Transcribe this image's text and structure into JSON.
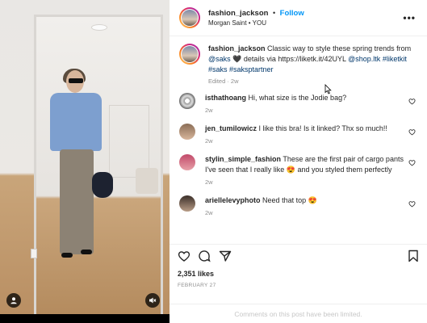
{
  "media": {
    "icons": {
      "user_tag": "person-icon",
      "mute": "speaker-muted-icon"
    }
  },
  "header": {
    "username": "fashion_jackson",
    "separator": "•",
    "follow_label": "Follow",
    "subline": "Morgan Saint • YOU",
    "more_label": "•••"
  },
  "caption": {
    "username": "fashion_jackson",
    "text_1": "Classic way to style these spring trends from",
    "saks": "@saks",
    "heart": "🖤",
    "text_2": "details via https://liketk.it/42UYL",
    "shop": "@shop.ltk",
    "tags1": "#liketkit",
    "tags2": "#saks #saksptartner",
    "meta": "Edited · 2w"
  },
  "comments": [
    {
      "user": "isthathoang",
      "text": "Hi, what size is the Jodie bag?",
      "time": "2w"
    },
    {
      "user": "jen_tumilowicz",
      "text": "I like this bra! Is it linked? Thx so much!!",
      "time": "2w"
    },
    {
      "user": "stylin_simple_fashion",
      "text": "These are the first pair of cargo pants I've seen that I really like 😍 and you styled them perfectly",
      "time": "2w"
    },
    {
      "user": "ariellelevyphoto",
      "text": "Need that top 😍",
      "time": "2w"
    }
  ],
  "stats": {
    "likes": "2,351 likes",
    "date": "FEBRUARY 27",
    "limited": "Comments on this post have been limited."
  },
  "colors": {
    "link": "#00376b",
    "follow": "#0095f6",
    "muted": "#8e8e8e"
  }
}
